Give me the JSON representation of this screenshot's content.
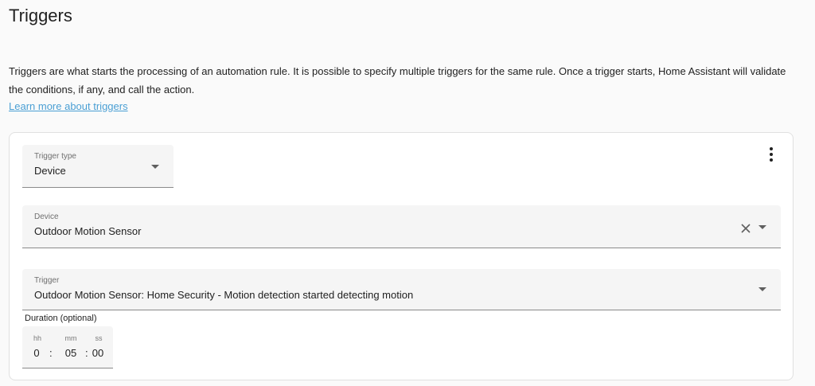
{
  "page": {
    "title": "Triggers",
    "description": "Triggers are what starts the processing of an automation rule. It is possible to specify multiple triggers for the same rule. Once a trigger starts, Home Assistant will validate the conditions, if any, and call the action.",
    "learn_more": "Learn more about triggers"
  },
  "trigger_card": {
    "menu_icon": "dots-vertical-icon",
    "trigger_type": {
      "label": "Trigger type",
      "value": "Device"
    },
    "device": {
      "label": "Device",
      "value": "Outdoor Motion Sensor",
      "clear_icon": "close-icon"
    },
    "trigger": {
      "label": "Trigger",
      "value": "Outdoor Motion Sensor: Home Security - Motion detection started detecting motion"
    },
    "duration": {
      "title": "Duration (optional)",
      "units": {
        "hours": "hh",
        "minutes": "mm",
        "seconds": "ss"
      },
      "values": {
        "hours": "0",
        "minutes": "05",
        "seconds": "00"
      },
      "separator": ":"
    }
  },
  "colors": {
    "link": "#4a9fd4",
    "field_bg": "#f5f5f5",
    "card_border": "#e0e0e0"
  }
}
